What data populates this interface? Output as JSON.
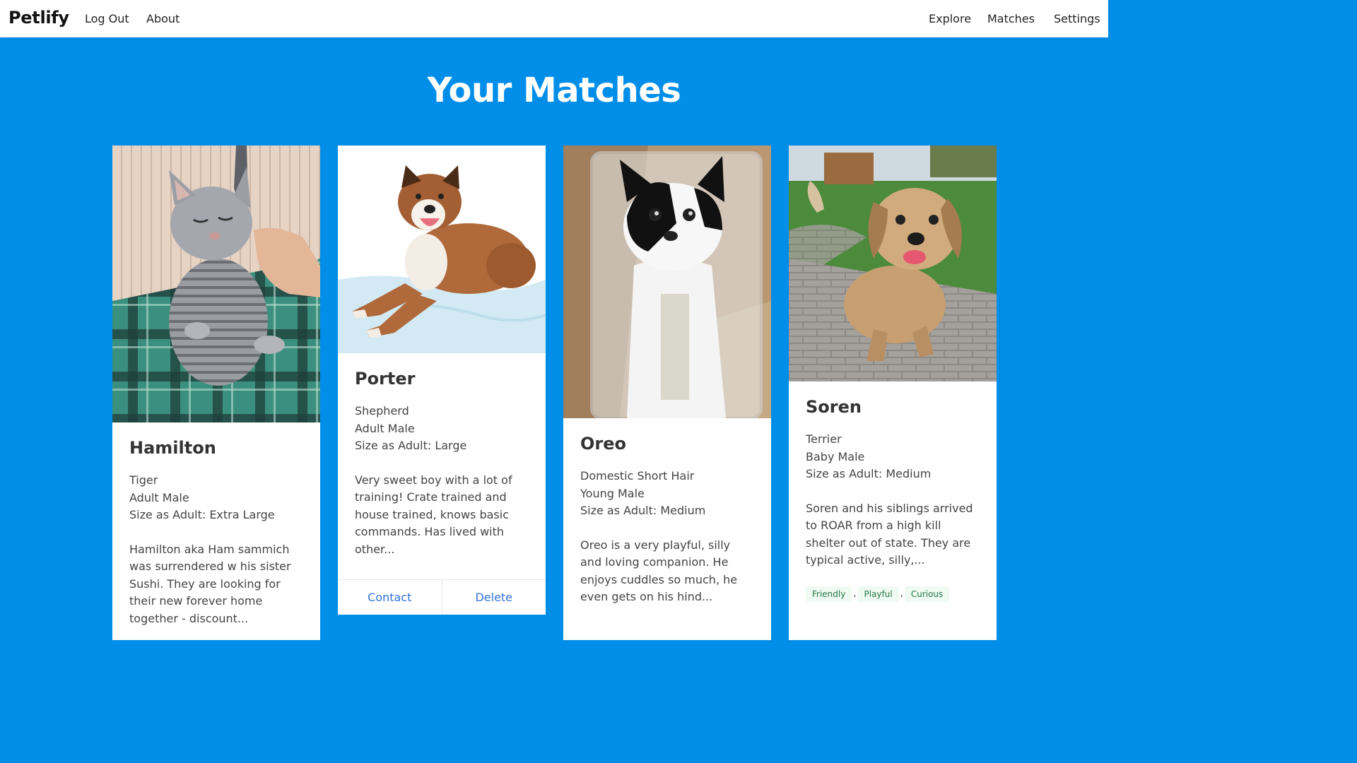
{
  "nav": {
    "brand": "Petlify",
    "left_links": [
      "Log Out",
      "About"
    ],
    "right_links": [
      "Explore",
      "Matches",
      "Settings"
    ]
  },
  "page": {
    "title": "Your Matches"
  },
  "cards": [
    {
      "name": "Hamilton",
      "breed": "Tiger",
      "age_sex": "Adult Male",
      "size": "Size as Adult: Extra Large",
      "description": "Hamilton aka Ham sammich was surrendered w his sister Sushi. They are looking for their new forever home together - discount...",
      "photo_alt": "gray tabby cat on green plaid blanket"
    },
    {
      "name": "Porter",
      "breed": "Shepherd",
      "age_sex": "Adult Male",
      "size": "Size as Adult: Large",
      "description": "Very sweet boy with a lot of training! Crate trained and house trained, knows basic commands. Has lived with other...",
      "actions": [
        "Contact",
        "Delete"
      ],
      "photo_alt": "brown and white shepherd mix lying on white blanket"
    },
    {
      "name": "Oreo",
      "breed": "Domestic Short Hair",
      "age_sex": "Young Male",
      "size": "Size as Adult: Medium",
      "description": "Oreo is a very playful, silly and loving companion. He enjoys cuddles so much, he even gets on his hind...",
      "photo_alt": "black and white cat in a plastic container"
    },
    {
      "name": "Soren",
      "breed": "Terrier",
      "age_sex": "Baby Male",
      "size": "Size as Adult: Medium",
      "description": "Soren and his siblings arrived to ROAR from a high kill shelter out of state. They are typical active, silly,...",
      "tags": [
        "Friendly",
        "Playful",
        "Curious"
      ],
      "tag_separator": ",",
      "photo_alt": "tan terrier puppy running on brick patio"
    }
  ],
  "colors": {
    "background": "#008ee9",
    "link": "#3273dc",
    "tag_bg": "#effaf3",
    "tag_text": "#257942"
  }
}
